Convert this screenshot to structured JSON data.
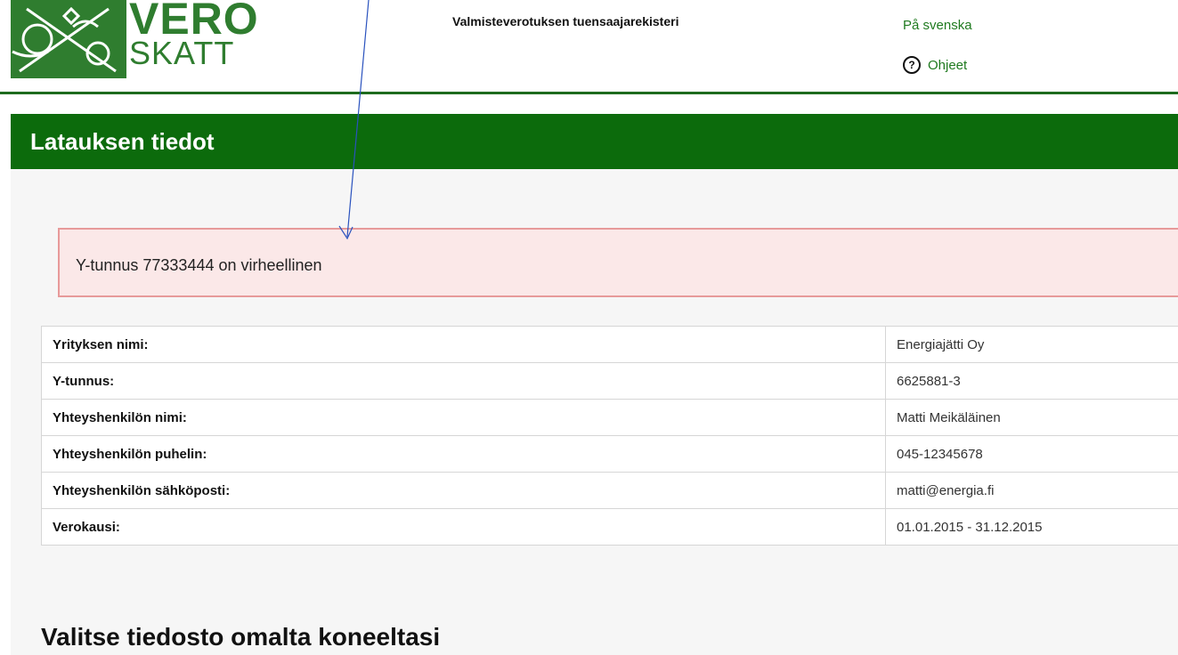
{
  "header": {
    "logo": {
      "text_line1": "VERO",
      "text_line2": "SKATT"
    },
    "app_title": "Valmisteverotuksen tuensaajarekisteri",
    "language_link": "På svenska",
    "help_link": "Ohjeet",
    "help_icon": "question-circle-icon"
  },
  "colors": {
    "brand_green": "#0c6b0c",
    "link_green": "#1f7a1f",
    "error_bg": "#fbe8e8",
    "error_border": "#e79a9a"
  },
  "page": {
    "title": "Latauksen tiedot",
    "error_message": "Y-tunnus 77333444 on virheellinen",
    "info_rows": [
      {
        "label": "Yrityksen nimi:",
        "value": "Energiajätti Oy"
      },
      {
        "label": "Y-tunnus:",
        "value": "6625881-3"
      },
      {
        "label": "Yhteyshenkilön nimi:",
        "value": "Matti Meikäläinen"
      },
      {
        "label": "Yhteyshenkilön puhelin:",
        "value": "045-12345678"
      },
      {
        "label": "Yhteyshenkilön sähköposti:",
        "value": "matti@energia.fi"
      },
      {
        "label": "Verokausi:",
        "value": "01.01.2015 - 31.12.2015"
      }
    ],
    "section_heading": "Valitse tiedosto omalta koneeltasi"
  }
}
